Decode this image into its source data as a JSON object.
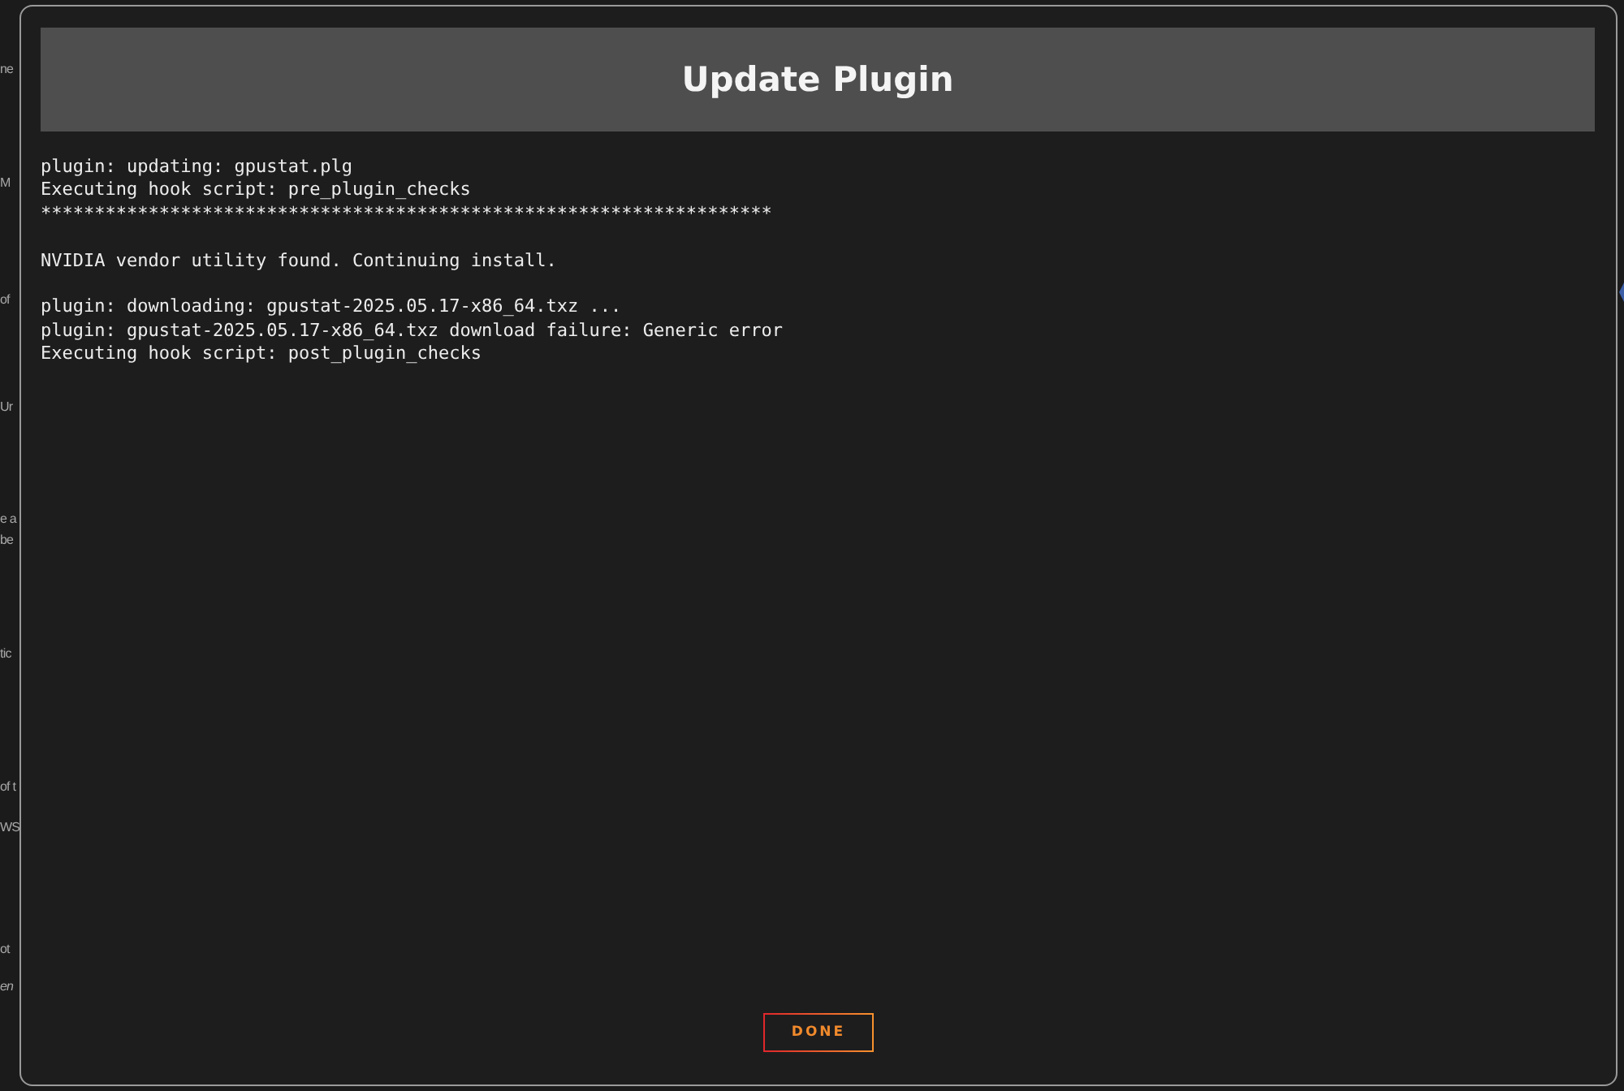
{
  "background_fragments": [
    {
      "text": "ne",
      "italic": false
    },
    {
      "text": "M",
      "italic": false
    },
    {
      "text": "of",
      "italic": false
    },
    {
      "text": "Ur",
      "italic": false
    },
    {
      "text": "e a",
      "italic": false
    },
    {
      "text": "be",
      "italic": false
    },
    {
      "text": "tic",
      "italic": false
    },
    {
      "text": "of t",
      "italic": false
    },
    {
      "text": "WS",
      "italic": false
    },
    {
      "text": "ot",
      "italic": false
    },
    {
      "text": "en",
      "italic": true
    }
  ],
  "dialog": {
    "title": "Update Plugin",
    "log_blocks": [
      [
        "plugin: updating: gpustat.plg",
        "Executing hook script: pre_plugin_checks",
        "********************************************************************"
      ],
      [
        "NVIDIA vendor utility found. Continuing install."
      ],
      [
        "plugin: downloading: gpustat-2025.05.17-x86_64.txz ...",
        "plugin: gpustat-2025.05.17-x86_64.txz download failure: Generic error",
        "Executing hook script: post_plugin_checks"
      ]
    ],
    "done_button": "DONE"
  }
}
